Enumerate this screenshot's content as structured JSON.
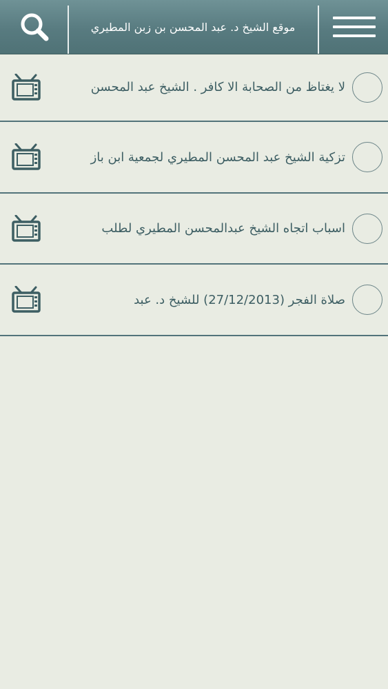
{
  "header": {
    "title": "موقع الشيخ د. عبد المحسن بن زبن المطيري",
    "search_icon": "search-icon",
    "menu_icon": "hamburger-menu-icon",
    "background": "#5b7e82"
  },
  "list": {
    "items": [
      {
        "label": "لا يغتاظ من الصحابة الا كافر . الشيخ عبد المحسن",
        "icon": "tv-icon"
      },
      {
        "label": "تزكية الشيخ عبد المحسن المطيري لجمعية ابن باز",
        "icon": "tv-icon"
      },
      {
        "label": "اسباب اتجاه الشيخ عبدالمحسن المطيري لطلب",
        "icon": "tv-icon"
      },
      {
        "label": "صلاة الفجر (27/12/2013)  للشيخ د. عبد",
        "icon": "tv-icon"
      }
    ]
  },
  "colors": {
    "accent": "#3d5e63",
    "page_background": "#e9ece3",
    "divider": "#52737a"
  }
}
